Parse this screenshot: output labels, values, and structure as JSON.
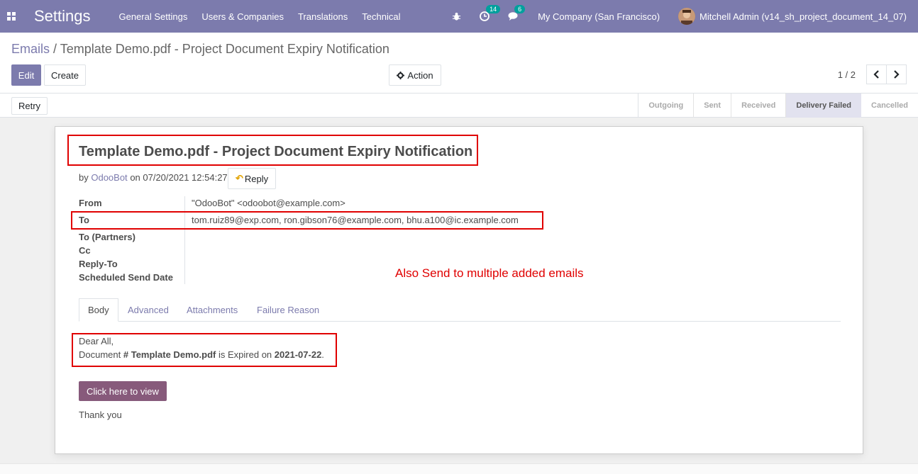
{
  "navbar": {
    "brand": "Settings",
    "menu": [
      "General Settings",
      "Users & Companies",
      "Translations",
      "Technical"
    ],
    "activities_count": "14",
    "messages_count": "6",
    "company": "My Company (San Francisco)",
    "user": "Mitchell Admin (v14_sh_project_document_14_07)"
  },
  "breadcrumb": {
    "parent": "Emails",
    "separator": "/",
    "current": "Template Demo.pdf - Project Document Expiry Notification"
  },
  "buttons": {
    "edit": "Edit",
    "create": "Create",
    "action": "Action",
    "retry": "Retry",
    "reply": "Reply",
    "view": "Click here to view"
  },
  "pager": {
    "value": "1 / 2"
  },
  "stages": [
    {
      "label": "Outgoing",
      "active": false
    },
    {
      "label": "Sent",
      "active": false
    },
    {
      "label": "Received",
      "active": false
    },
    {
      "label": "Delivery Failed",
      "active": true
    },
    {
      "label": "Cancelled",
      "active": false
    }
  ],
  "mail": {
    "subject": "Template Demo.pdf - Project Document Expiry Notification",
    "by_prefix": "by",
    "author": "OdooBot",
    "date_text": "on 07/20/2021 12:54:27",
    "fields": [
      {
        "label": "From",
        "value": "\"OdooBot\" <odoobot@example.com>"
      },
      {
        "label": "To",
        "value": "tom.ruiz89@exp.com, ron.gibson76@example.com, bhu.a100@ic.example.com"
      },
      {
        "label": "To (Partners)",
        "value": ""
      },
      {
        "label": "Cc",
        "value": ""
      },
      {
        "label": "Reply-To",
        "value": ""
      },
      {
        "label": "Scheduled Send Date",
        "value": ""
      }
    ],
    "tabs": [
      "Body",
      "Advanced",
      "Attachments",
      "Failure Reason"
    ],
    "body": {
      "greeting": "Dear All,",
      "line_prefix": "Document",
      "doc_name": "# Template Demo.pdf",
      "line_mid": "is Expired on",
      "expiry_date": "2021-07-22",
      "line_end": ".",
      "thanks": "Thank you"
    }
  },
  "annotation": "Also Send to multiple added emails",
  "colors": {
    "navbar": "#7c7bad",
    "primary": "#7c7bad",
    "view_button": "#875a7b",
    "highlight": "#e00000",
    "badge": "#00a09d"
  }
}
